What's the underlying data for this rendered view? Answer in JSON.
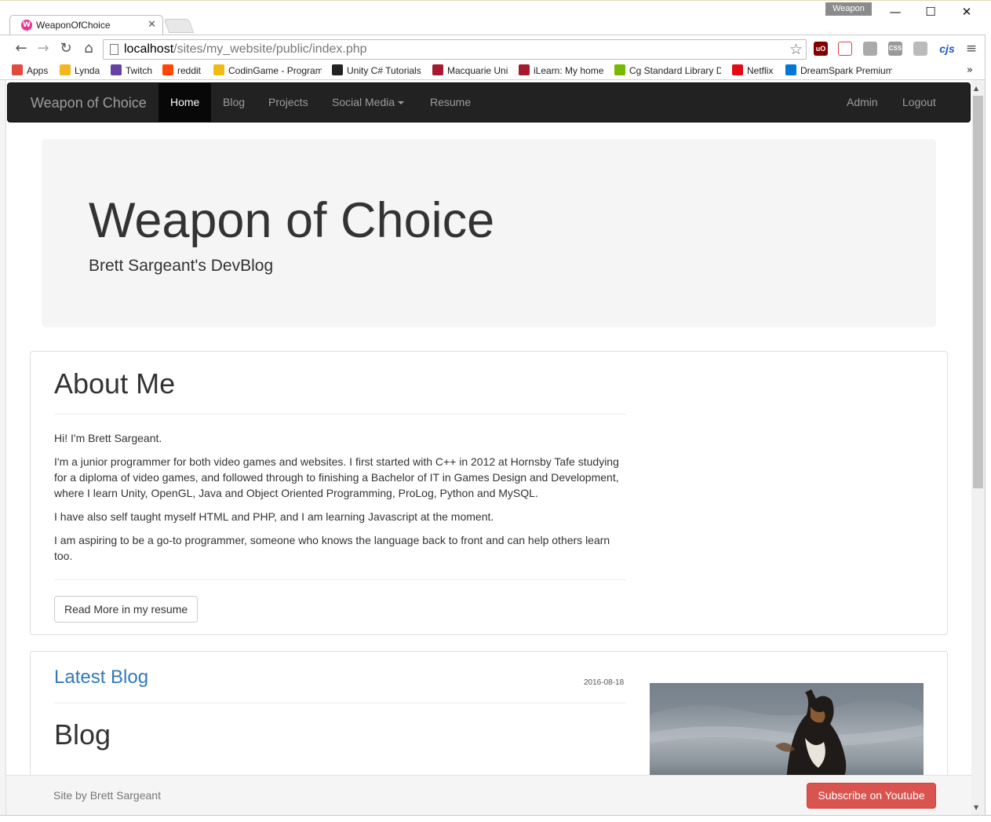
{
  "browser": {
    "tab_title": "WeaponOfChoice",
    "tab_favicon": "W",
    "profile_name": "Weapon",
    "url_host": "localhost",
    "url_path": "/sites/my_website/public/index.php",
    "ext_ublock": "uO",
    "ext_css": "CSS",
    "ext_cjs": "cjs"
  },
  "bookmarks": [
    {
      "label": "Apps",
      "icon": "apps-grid-icon",
      "color": "#e04a3f"
    },
    {
      "label": "Lynda",
      "icon": "lynda-icon",
      "color": "#f2b720"
    },
    {
      "label": "Twitch",
      "icon": "twitch-icon",
      "color": "#6441a5"
    },
    {
      "label": "reddit",
      "icon": "reddit-icon",
      "color": "#ff4500"
    },
    {
      "label": "CodinGame - Program",
      "icon": "codingame-icon",
      "color": "#f2bb13"
    },
    {
      "label": "Unity C# Tutorials",
      "icon": "unity-icon",
      "color": "#222222"
    },
    {
      "label": "Macquarie Uni",
      "icon": "macquarie-icon",
      "color": "#a6192e"
    },
    {
      "label": "iLearn: My home",
      "icon": "ilearn-icon",
      "color": "#a6192e"
    },
    {
      "label": "Cg Standard Library D",
      "icon": "cg-icon",
      "color": "#76b900"
    },
    {
      "label": "Netflix",
      "icon": "netflix-icon",
      "color": "#e50914"
    },
    {
      "label": "DreamSpark Premium",
      "icon": "dreamspark-icon",
      "color": "#0078d7"
    }
  ],
  "navbar": {
    "brand": "Weapon of Choice",
    "links": [
      "Home",
      "Blog",
      "Projects",
      "Social Media",
      "Resume"
    ],
    "right_links": [
      "Admin",
      "Logout"
    ]
  },
  "jumbotron": {
    "title": "Weapon of Choice",
    "subtitle": "Brett Sargeant's DevBlog"
  },
  "about": {
    "heading": "About Me",
    "paragraphs": [
      "Hi! I'm Brett Sargeant.",
      "I'm a junior programmer for both video games and websites. I first started with C++ in 2012 at Hornsby Tafe studying for a diploma of video games, and followed through to finishing a Bachelor of IT in Games Design and Development, where I learn Unity, OpenGL, Java and Object Oriented Programming, ProLog, Python and MySQL.",
      "I have also self taught myself HTML and PHP, and I am learning Javascript at the moment.",
      "I am aspiring to be a go-to programmer, someone who knows the language back to front and can help others learn too."
    ],
    "button": "Read More in my resume"
  },
  "latest_blog": {
    "heading": "Latest Blog",
    "date": "2016-08-18",
    "title": "Blog"
  },
  "footer": {
    "text": "Site by Brett Sargeant",
    "button": "Subscribe on Youtube"
  },
  "colors": {
    "navbar_bg": "#222222",
    "link_blue": "#337ab7",
    "danger": "#d9534f"
  }
}
